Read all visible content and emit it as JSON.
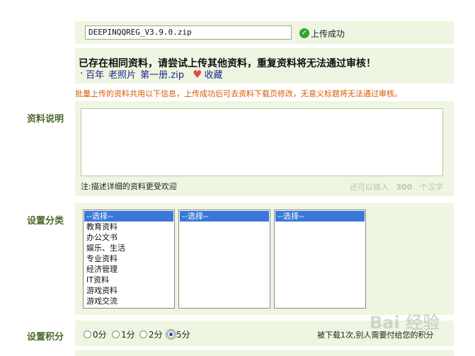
{
  "upload": {
    "file_name": "DEEPINQQREG_V3.9.0.zip",
    "status": "上传成功",
    "status_icon": "check-circle-icon"
  },
  "warning": {
    "title": "已存在相同资料，请尝试上传其他资料，重复资料将无法通过审核！",
    "bullet": "·",
    "words": [
      "百年",
      "老照片",
      "第一册.zip"
    ],
    "favorite_label": "收藏",
    "favorite_icon": "heart-icon"
  },
  "notice": "批量上传的资料共用以下信息，上传成功后可去资料下载页修改，无意义标题将无法通过审核。",
  "description": {
    "label": "资料说明",
    "value": "",
    "note": "注:描述详细的资料更受欢迎",
    "counter_prefix": "还可以输入",
    "counter_value": "300",
    "counter_suffix": "个汉字"
  },
  "category": {
    "label": "设置分类",
    "list1": {
      "selected": "--选择--",
      "options": [
        "教育资料",
        "办公文书",
        "娱乐、生活",
        "专业资料",
        "经济管理",
        "IT资料",
        "游戏资料",
        "游戏交流"
      ]
    },
    "list2": {
      "selected": "--选择--"
    },
    "list3": {
      "selected": "--选择--"
    }
  },
  "points": {
    "label": "设置积分",
    "options": [
      "0分",
      "1分",
      "2分",
      "5分"
    ],
    "selected": "5分",
    "note": "被下载1次,别人需要付给您的积分"
  },
  "watermark": "Bai 经验",
  "colors": {
    "panel_bg": "#eef5e1",
    "label_green": "#4c6a2a",
    "notice_orange": "#d85a00",
    "link_blue": "#1a2a8a",
    "selection_blue": "#3a78d8"
  }
}
